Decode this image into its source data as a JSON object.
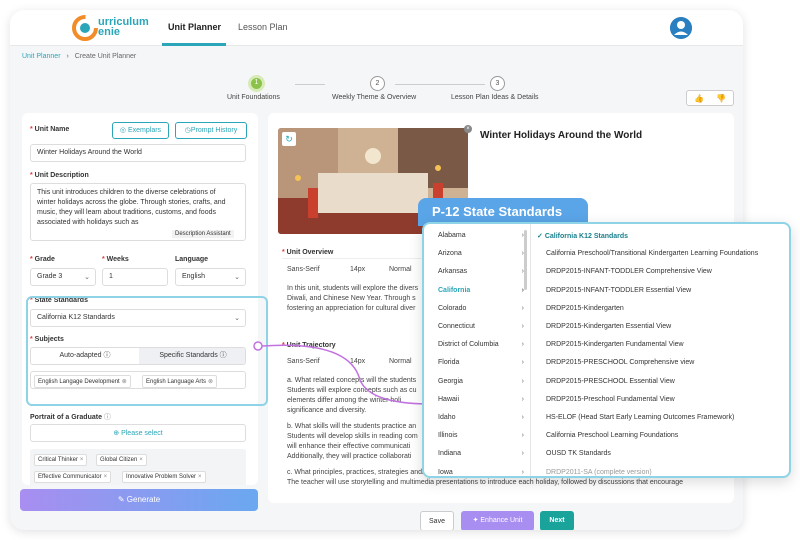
{
  "app": {
    "logo_text_1": "urriculum",
    "logo_text_2": "enie",
    "tabs": [
      "Unit Planner",
      "Lesson Plan"
    ]
  },
  "breadcrumb": {
    "root": "Unit Planner",
    "sep": "›",
    "current": "Create Unit Planner"
  },
  "steps": [
    {
      "num": "1",
      "label": "Unit Foundations"
    },
    {
      "num": "2",
      "label": "Weekly Theme & Overview"
    },
    {
      "num": "3",
      "label": "Lesson Plan Ideas & Details"
    }
  ],
  "left": {
    "unit_name_label": "Unit Name",
    "exemplars": "Exemplars",
    "prompt_history": "Prompt History",
    "unit_name_value": "Winter Holidays Around the World",
    "unit_desc_label": "Unit Description",
    "unit_desc_value": "This unit introduces children to the diverse celebrations of winter holidays across the globe. Through stories, crafts, and music, they will learn about traditions, customs, and foods associated with holidays such as",
    "desc_assistant": "Description Assistant",
    "grade_label": "Grade",
    "grade_value": "Grade 3",
    "weeks_label": "Weeks",
    "weeks_value": "1",
    "language_label": "Language",
    "language_value": "English",
    "state_label": "State Standards",
    "state_value": "California K12 Standards",
    "subjects_label": "Subjects",
    "auto_adapted": "Auto-adapted",
    "specific_standards": "Specific Standards",
    "subject_chips": [
      "English Langage Development",
      "English Language Arts"
    ],
    "portrait_label": "Portrait of a Graduate",
    "please_select": "Please select",
    "portrait_chips": [
      "Critical Thinker",
      "Global Citizen",
      "Effective Communicator",
      "Innovative Problem Solver"
    ],
    "generate": "Generate"
  },
  "main": {
    "title": "Winter Holidays Around the World",
    "overview_label": "Unit Overview",
    "font": "Sans-Serif",
    "size": "14px",
    "style": "Normal",
    "overview_lines": [
      "In this unit, students will explore the divers",
      "Diwali, and Chinese New Year. Through s",
      "fostering an appreciation for cultural diver"
    ],
    "trajectory_label": "Unit Trajectory",
    "traj_lines": [
      "a. What related concepts will the students",
      "Students will explore concepts such as cu",
      "elements differ among the winter holi",
      "significance and diversity.",
      "",
      "b. What skills will the students practice an",
      "Students will develop skills in reading com",
      "will enhance their effective communicati",
      "Additionally, they will practice collaborati",
      "",
      "c. What principles, practices, strategies and/or approaches will the teacher use?",
      "The teacher will use storytelling and multimedia presentations to introduce each holiday, followed by discussions that encourage"
    ],
    "save": "Save",
    "enhance": "Enhance Unit",
    "next": "Next"
  },
  "popup": {
    "title": "P-12 State Standards",
    "states": [
      "Alabama",
      "Arizona",
      "Arkansas",
      "California",
      "Colorado",
      "Connecticut",
      "District of Columbia",
      "Florida",
      "Georgia",
      "Hawaii",
      "Idaho",
      "Illinois",
      "Indiana",
      "Iowa"
    ],
    "selected_state": "California",
    "standards": [
      "California K12 Standards",
      "California Preschool/Transitional Kindergarten Learning Foundations",
      "DRDP2015-INFANT-TODDLER Comprehensive View",
      "DRDP2015-INFANT-TODDLER Essential View",
      "DRDP2015-Kindergarten",
      "DRDP2015-Kindergarten Essential View",
      "DRDP2015-Kindergarten Fundamental View",
      "DRDP2015-PRESCHOOL Comprehensive view",
      "DRDP2015-PRESCHOOL Essential View",
      "DRDP2015-Preschool Fundamental View",
      "HS-ELOF (Head Start Early Learning Outcomes Framework)",
      "California Preschool Learning Foundations",
      "OUSD TK Standards",
      "DRDP2011-SA (complete version)"
    ]
  }
}
